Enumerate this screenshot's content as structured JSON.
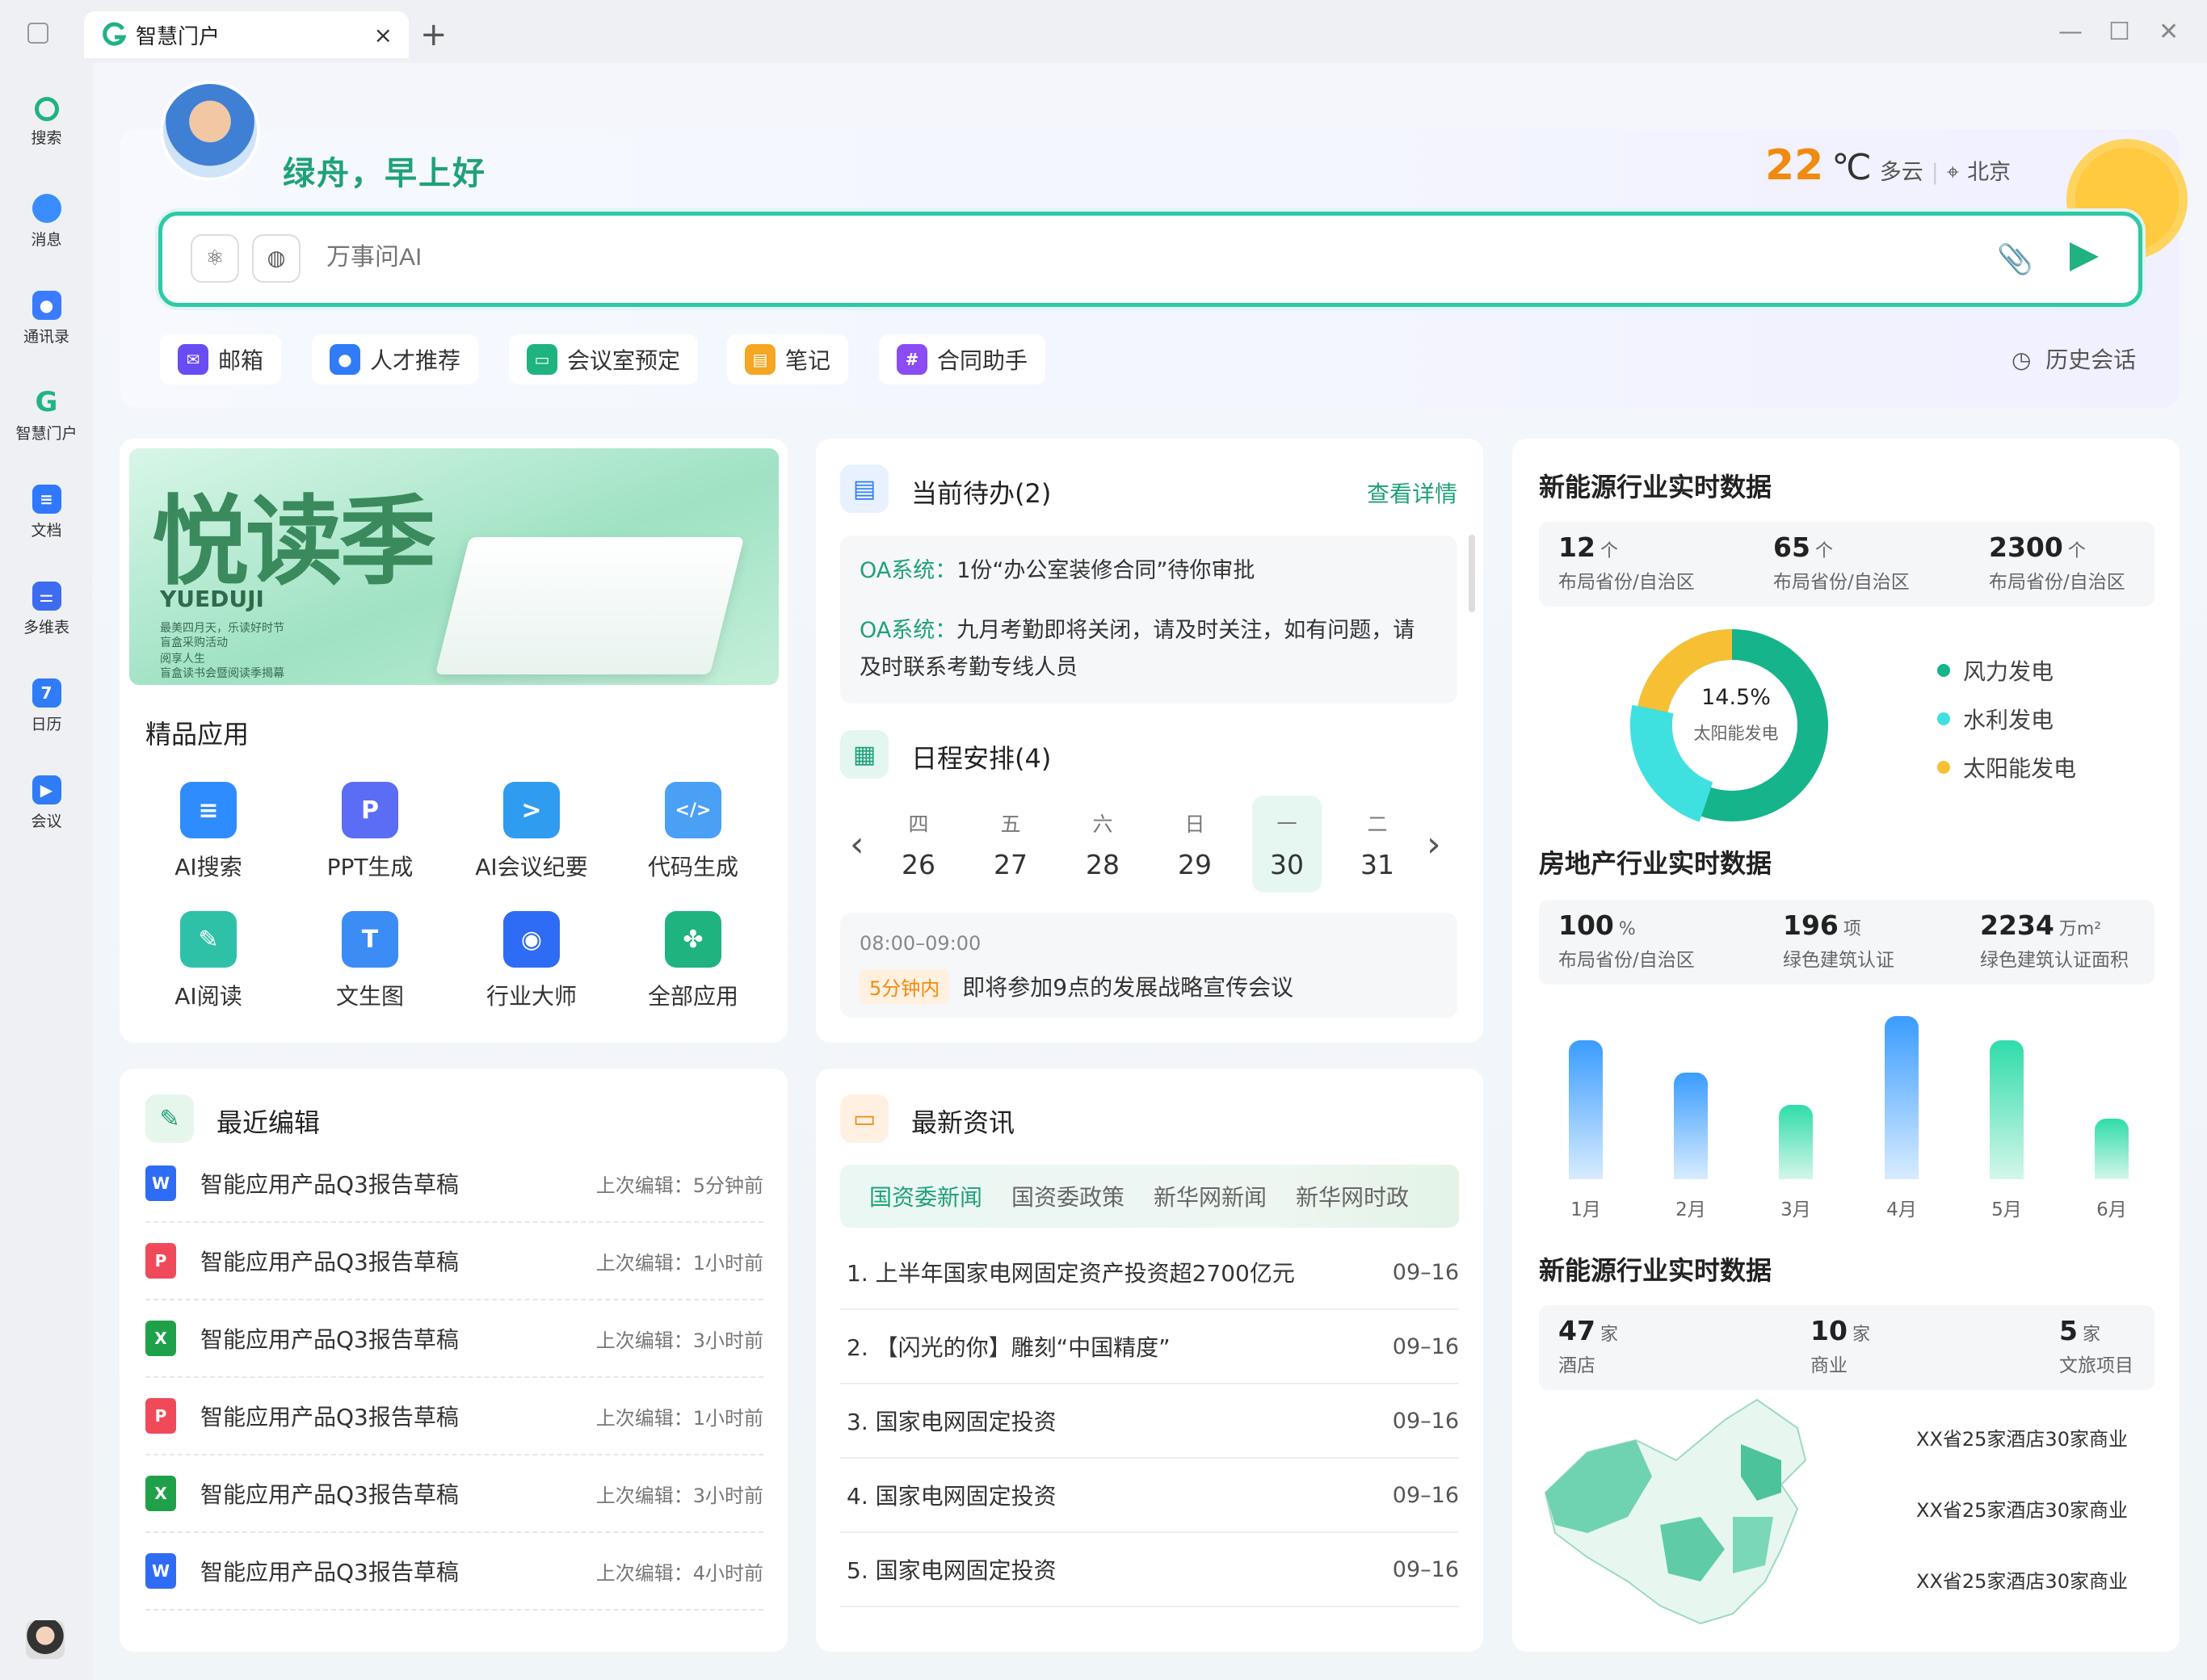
{
  "window": {
    "tab_title": "智慧门户",
    "tab_close": "×",
    "new_tab": "+",
    "min": "—",
    "max": "☐",
    "close": "✕"
  },
  "nav": [
    {
      "label": "搜索",
      "icon": "search-icon",
      "color": "#1fb37f"
    },
    {
      "label": "消息",
      "icon": "message-icon",
      "color": "#3a8dff"
    },
    {
      "label": "通讯录",
      "icon": "contacts-icon",
      "color": "#3a7bff"
    },
    {
      "label": "智慧门户",
      "icon": "portal-icon",
      "color": "#22b388"
    },
    {
      "label": "文档",
      "icon": "document-icon",
      "color": "#2f78ff"
    },
    {
      "label": "多维表",
      "icon": "table-icon",
      "color": "#3e6cf0"
    },
    {
      "label": "日历",
      "icon": "calendar-icon",
      "color": "#2f7cf6"
    },
    {
      "label": "会议",
      "icon": "meeting-icon",
      "color": "#2f7cf6"
    }
  ],
  "header": {
    "greeting": "绿舟，早上好",
    "temperature": "22",
    "temp_unit": "℃",
    "weather": "多云",
    "divider": "|",
    "city": "北京",
    "search_placeholder": "万事问AI",
    "history": "历史会话",
    "chips": [
      {
        "label": "邮箱",
        "color": "#6a4cf5",
        "glyph": "✉"
      },
      {
        "label": "人才推荐",
        "color": "#2f7cf6",
        "glyph": "👤"
      },
      {
        "label": "会议室预定",
        "color": "#1fb37f",
        "glyph": "▭"
      },
      {
        "label": "笔记",
        "color": "#f5a623",
        "glyph": "▤"
      },
      {
        "label": "合同助手",
        "color": "#8a4cf5",
        "glyph": "#"
      }
    ]
  },
  "banner": {
    "title": "悦读季",
    "subtitle": "YUEDUJI",
    "lines": [
      "最美四月天，乐读好时节",
      "盲盒采购活动",
      "阅享人生",
      "盲盒读书会暨阅读季揭幕"
    ]
  },
  "apps": {
    "title": "精品应用",
    "items": [
      {
        "label": "AI搜索",
        "color": "#2f8cff",
        "glyph": "≡"
      },
      {
        "label": "PPT生成",
        "color": "#5b6cf5",
        "glyph": "P"
      },
      {
        "label": "AI会议纪要",
        "color": "#2f9cf0",
        "glyph": ">"
      },
      {
        "label": "代码生成",
        "color": "#4aa0f5",
        "glyph": "</>"
      },
      {
        "label": "AI阅读",
        "color": "#2fc1a8",
        "glyph": "✎"
      },
      {
        "label": "文生图",
        "color": "#3c8cf5",
        "glyph": "T"
      },
      {
        "label": "行业大师",
        "color": "#2f6cf5",
        "glyph": "◉"
      },
      {
        "label": "全部应用",
        "color": "#1fb37f",
        "glyph": "✤"
      }
    ]
  },
  "todo": {
    "title": "当前待办(2)",
    "details_link": "查看详情",
    "items": [
      {
        "system": "OA系统：",
        "text": "1份“办公室装修合同”待你审批"
      },
      {
        "system": "OA系统：",
        "text": "九月考勤即将关闭，请及时关注，如有问题，请",
        "text2": "及时联系考勤专线人员"
      }
    ]
  },
  "schedule": {
    "title": "日程安排(4)",
    "prev": "‹",
    "next": "›",
    "days": [
      {
        "week": "四",
        "date": "26"
      },
      {
        "week": "五",
        "date": "27"
      },
      {
        "week": "六",
        "date": "28"
      },
      {
        "week": "日",
        "date": "29"
      },
      {
        "week": "一",
        "date": "30",
        "selected": true
      },
      {
        "week": "二",
        "date": "31"
      }
    ],
    "event_time": "08:00–09:00",
    "event_badge": "5分钟内",
    "event_title": "即将参加9点的发展战略宣传会议"
  },
  "recent": {
    "title": "最近编辑",
    "rows": [
      {
        "type": "W",
        "color": "#2f6cf5",
        "name": "智能应用产品Q3报告草稿",
        "meta": "上次编辑：5分钟前"
      },
      {
        "type": "P",
        "color": "#f04a5a",
        "name": "智能应用产品Q3报告草稿",
        "meta": "上次编辑：1小时前"
      },
      {
        "type": "X",
        "color": "#1fa14a",
        "name": "智能应用产品Q3报告草稿",
        "meta": "上次编辑：3小时前"
      },
      {
        "type": "P",
        "color": "#f04a5a",
        "name": "智能应用产品Q3报告草稿",
        "meta": "上次编辑：1小时前"
      },
      {
        "type": "X",
        "color": "#1fa14a",
        "name": "智能应用产品Q3报告草稿",
        "meta": "上次编辑：3小时前"
      },
      {
        "type": "W",
        "color": "#2f6cf5",
        "name": "智能应用产品Q3报告草稿",
        "meta": "上次编辑：4小时前"
      }
    ]
  },
  "news": {
    "title": "最新资讯",
    "tabs": [
      "国资委新闻",
      "国资委政策",
      "新华网新闻",
      "新华网时政"
    ],
    "rows": [
      {
        "title": "1. 上半年国家电网固定资产投资超2700亿元",
        "date": "09–16"
      },
      {
        "title": "2. 【闪光的你】雕刻“中国精度”",
        "date": "09–16"
      },
      {
        "title": "3. 国家电网固定投资",
        "date": "09–16"
      },
      {
        "title": "4. 国家电网固定投资",
        "date": "09–16"
      },
      {
        "title": "5. 国家电网固定投资",
        "date": "09–16"
      }
    ]
  },
  "energy": {
    "title": "新能源行业实时数据",
    "stats": [
      {
        "value": "12",
        "unit": "个",
        "label": "布局省份/自治区"
      },
      {
        "value": "65",
        "unit": "个",
        "label": "布局省份/自治区"
      },
      {
        "value": "2300",
        "unit": "个",
        "label": "布局省份/自治区"
      }
    ],
    "donut_center_value": "14.5%",
    "donut_center_label": "太阳能发电",
    "legend": [
      {
        "name": "风力发电",
        "color": "#16b48a"
      },
      {
        "name": "水利发电",
        "color": "#3fe0e0"
      },
      {
        "name": "太阳能发电",
        "color": "#f7c034"
      }
    ]
  },
  "realestate": {
    "title": "房地产行业实时数据",
    "stats": [
      {
        "value": "100",
        "unit": "%",
        "label": "布局省份/自治区"
      },
      {
        "value": "196",
        "unit": "项",
        "label": "绿色建筑认证"
      },
      {
        "value": "2234",
        "unit": "万m²",
        "label": "绿色建筑认证面积"
      }
    ]
  },
  "chart_data": {
    "type": "bar",
    "categories": [
      "1月",
      "2月",
      "3月",
      "4月",
      "5月",
      "6月"
    ],
    "values": [
      78,
      60,
      42,
      92,
      78,
      34
    ],
    "colors": [
      "blue",
      "blue",
      "green",
      "blue",
      "green",
      "green"
    ],
    "ylim": [
      0,
      100
    ]
  },
  "energy2": {
    "title": "新能源行业实时数据",
    "stats": [
      {
        "value": "47",
        "unit": "家",
        "label": "酒店"
      },
      {
        "value": "10",
        "unit": "家",
        "label": "商业"
      },
      {
        "value": "5",
        "unit": "家",
        "label": "文旅项目"
      }
    ],
    "map_labels": [
      "XX省25家酒店30家商业",
      "XX省25家酒店30家商业",
      "XX省25家酒店30家商业"
    ]
  }
}
